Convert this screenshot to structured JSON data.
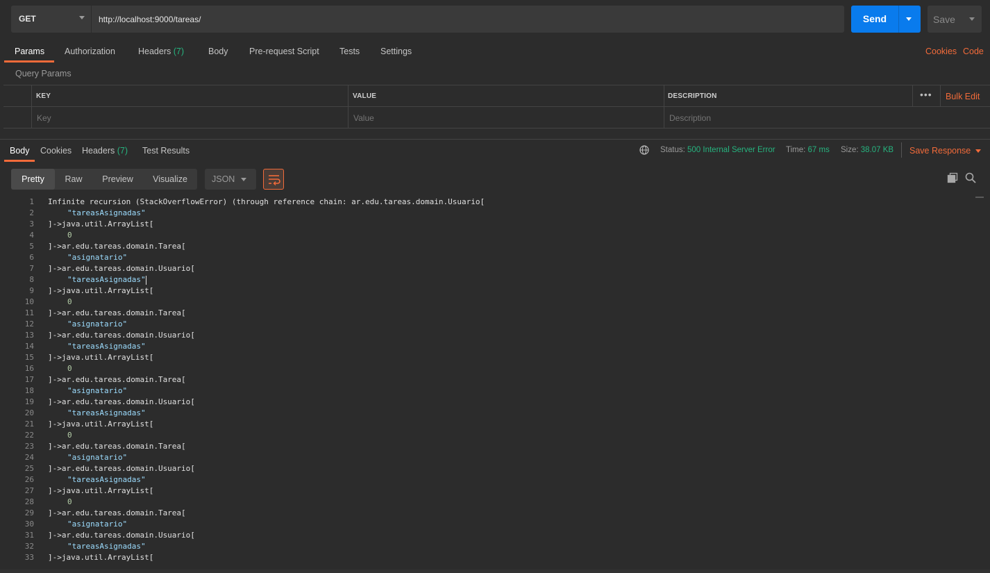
{
  "request": {
    "method": "GET",
    "url": "http://localhost:9000/tareas/",
    "send_label": "Send",
    "save_label": "Save"
  },
  "request_tabs": {
    "params": "Params",
    "authorization": "Authorization",
    "headers": "Headers",
    "headers_count": "(7)",
    "body": "Body",
    "prerequest": "Pre-request Script",
    "tests": "Tests",
    "settings": "Settings",
    "cookies": "Cookies",
    "code": "Code"
  },
  "query_params": {
    "title": "Query Params",
    "columns": {
      "key": "KEY",
      "value": "VALUE",
      "description": "DESCRIPTION"
    },
    "placeholders": {
      "key": "Key",
      "value": "Value",
      "description": "Description"
    },
    "bulk_edit": "Bulk Edit",
    "more": "•••"
  },
  "response_tabs": {
    "body": "Body",
    "cookies": "Cookies",
    "headers": "Headers",
    "headers_count": "(7)",
    "test_results": "Test Results"
  },
  "status": {
    "status_label": "Status:",
    "status_value": "500 Internal Server Error",
    "time_label": "Time:",
    "time_value": "67 ms",
    "size_label": "Size:",
    "size_value": "38.07 KB",
    "save_response": "Save Response"
  },
  "view": {
    "pretty": "Pretty",
    "raw": "Raw",
    "preview": "Preview",
    "visualize": "Visualize",
    "format": "JSON"
  },
  "code_lines": [
    {
      "n": "1",
      "t": "Infinite recursion (StackOverflowError) (through reference chain: ar.edu.tareas.domain.Usuario[",
      "k": "plain"
    },
    {
      "n": "2",
      "t": "\"tareasAsignadas\"",
      "k": "str"
    },
    {
      "n": "3",
      "t": "]->java.util.ArrayList[",
      "k": "plain"
    },
    {
      "n": "4",
      "t": "0",
      "k": "num"
    },
    {
      "n": "5",
      "t": "]->ar.edu.tareas.domain.Tarea[",
      "k": "plain"
    },
    {
      "n": "6",
      "t": "\"asignatario\"",
      "k": "str"
    },
    {
      "n": "7",
      "t": "]->ar.edu.tareas.domain.Usuario[",
      "k": "plain"
    },
    {
      "n": "8",
      "t": "\"tareasAsignadas\"",
      "k": "str"
    },
    {
      "n": "9",
      "t": "]->java.util.ArrayList[",
      "k": "plain"
    },
    {
      "n": "10",
      "t": "0",
      "k": "num"
    },
    {
      "n": "11",
      "t": "]->ar.edu.tareas.domain.Tarea[",
      "k": "plain"
    },
    {
      "n": "12",
      "t": "\"asignatario\"",
      "k": "str"
    },
    {
      "n": "13",
      "t": "]->ar.edu.tareas.domain.Usuario[",
      "k": "plain"
    },
    {
      "n": "14",
      "t": "\"tareasAsignadas\"",
      "k": "str"
    },
    {
      "n": "15",
      "t": "]->java.util.ArrayList[",
      "k": "plain"
    },
    {
      "n": "16",
      "t": "0",
      "k": "num"
    },
    {
      "n": "17",
      "t": "]->ar.edu.tareas.domain.Tarea[",
      "k": "plain"
    },
    {
      "n": "18",
      "t": "\"asignatario\"",
      "k": "str"
    },
    {
      "n": "19",
      "t": "]->ar.edu.tareas.domain.Usuario[",
      "k": "plain"
    },
    {
      "n": "20",
      "t": "\"tareasAsignadas\"",
      "k": "str"
    },
    {
      "n": "21",
      "t": "]->java.util.ArrayList[",
      "k": "plain"
    },
    {
      "n": "22",
      "t": "0",
      "k": "num"
    },
    {
      "n": "23",
      "t": "]->ar.edu.tareas.domain.Tarea[",
      "k": "plain"
    },
    {
      "n": "24",
      "t": "\"asignatario\"",
      "k": "str"
    },
    {
      "n": "25",
      "t": "]->ar.edu.tareas.domain.Usuario[",
      "k": "plain"
    },
    {
      "n": "26",
      "t": "\"tareasAsignadas\"",
      "k": "str"
    },
    {
      "n": "27",
      "t": "]->java.util.ArrayList[",
      "k": "plain"
    },
    {
      "n": "28",
      "t": "0",
      "k": "num"
    },
    {
      "n": "29",
      "t": "]->ar.edu.tareas.domain.Tarea[",
      "k": "plain"
    },
    {
      "n": "30",
      "t": "\"asignatario\"",
      "k": "str"
    },
    {
      "n": "31",
      "t": "]->ar.edu.tareas.domain.Usuario[",
      "k": "plain"
    },
    {
      "n": "32",
      "t": "\"tareasAsignadas\"",
      "k": "str"
    },
    {
      "n": "33",
      "t": "]->java.util.ArrayList[",
      "k": "plain"
    }
  ],
  "colors": {
    "accent": "#f26b3a",
    "send": "#097bed",
    "status_ok": "#26b47f",
    "string": "#9cdcfe",
    "number": "#b5cea8"
  }
}
